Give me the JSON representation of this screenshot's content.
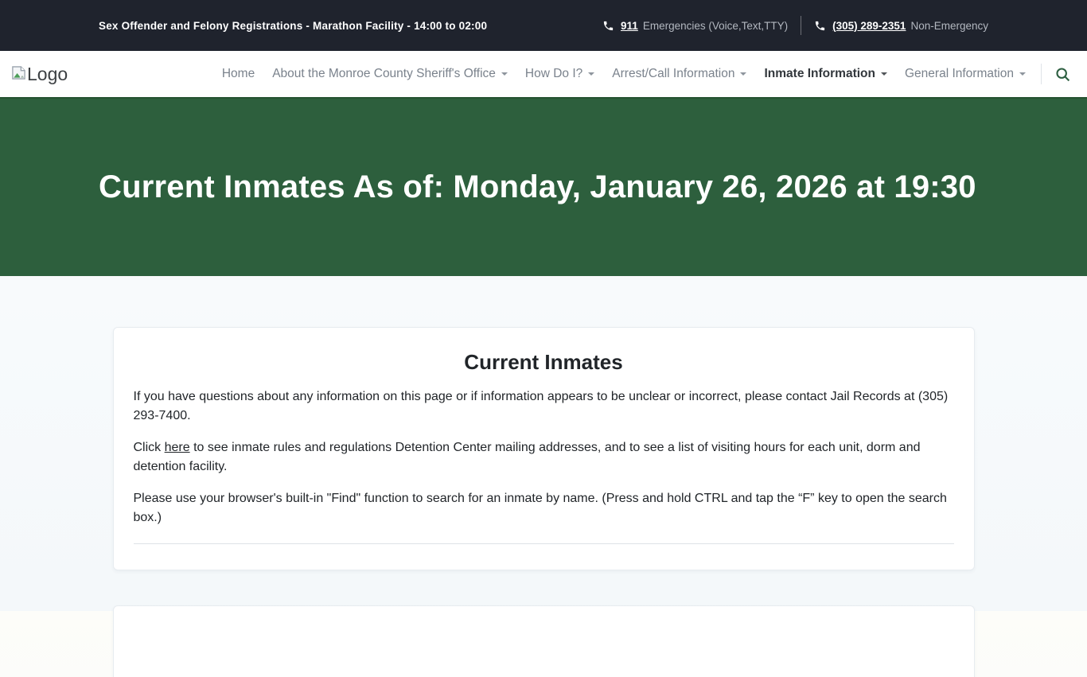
{
  "topbar": {
    "announcement": "Sex Offender and Felony Registrations - Marathon Facility - 14:00 to 02:00",
    "emergency": {
      "number": "911",
      "label": "Emergencies (Voice,Text,TTY)"
    },
    "non_emergency": {
      "number": "(305) 289-2351",
      "label": "Non-Emergency"
    }
  },
  "navbar": {
    "logo_alt": "Logo",
    "items": [
      {
        "label": "Home",
        "dropdown": false,
        "active": false
      },
      {
        "label": "About the Monroe County Sheriff's Office",
        "dropdown": true,
        "active": false
      },
      {
        "label": "How Do I?",
        "dropdown": true,
        "active": false
      },
      {
        "label": "Arrest/Call Information",
        "dropdown": true,
        "active": false
      },
      {
        "label": "Inmate Information",
        "dropdown": true,
        "active": true
      },
      {
        "label": "General Information",
        "dropdown": true,
        "active": false
      }
    ],
    "search_icon": "magnifier-icon"
  },
  "hero": {
    "title": "Current Inmates As of: Monday, January 26, 2026 at 19:30"
  },
  "content": {
    "heading": "Current Inmates",
    "paragraph1": "If you have questions about any information on this page or if information appears to be unclear or incorrect, please contact Jail Records at (305) 293-7400.",
    "paragraph2_prefix": "Click ",
    "paragraph2_link": "here",
    "paragraph2_suffix": " to see inmate rules and regulations Detention Center mailing addresses, and to see a list of visiting hours for each unit, dorm and detention facility.",
    "paragraph3": "Please use your browser's built-in \"Find\" function to search for an inmate by name. (Press and hold CTRL and tap the “F” key to open the search box.)"
  },
  "colors": {
    "topbar_dark": "#1f232d",
    "hero_green": "#2d5f3d",
    "accent_green": "#2d5f41",
    "nav_text": "#7a828c",
    "body_text": "#212529"
  }
}
